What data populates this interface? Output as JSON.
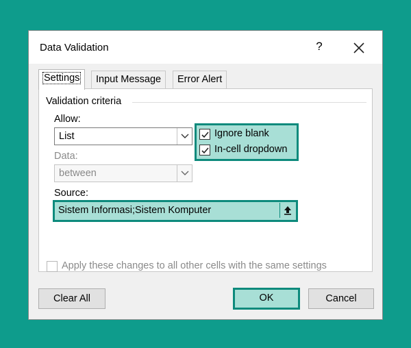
{
  "dialog": {
    "title": "Data Validation",
    "help_label": "?",
    "close_icon": "close-icon"
  },
  "tabs": [
    {
      "label": "Settings",
      "active": true
    },
    {
      "label": "Input Message",
      "active": false
    },
    {
      "label": "Error Alert",
      "active": false
    }
  ],
  "criteria": {
    "group_title": "Validation criteria",
    "allow_label": "Allow:",
    "allow_value": "List",
    "data_label": "Data:",
    "data_value": "between",
    "ignore_blank_label": "Ignore blank",
    "ignore_blank_checked": true,
    "incell_dropdown_label": "In-cell dropdown",
    "incell_dropdown_checked": true,
    "source_label": "Source:",
    "source_value": "Sistem Informasi;Sistem Komputer"
  },
  "apply_all": {
    "label": "Apply these changes to all other cells with the same settings",
    "checked": false
  },
  "buttons": {
    "clear_all": "Clear All",
    "ok": "OK",
    "cancel": "Cancel"
  },
  "colors": {
    "background": "#0e9c8c",
    "highlight_fill": "#a8dfd6",
    "highlight_border": "#0d8a7c"
  }
}
